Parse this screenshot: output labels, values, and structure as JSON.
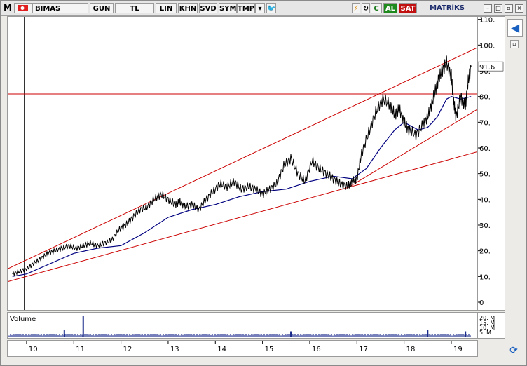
{
  "toolbar": {
    "symbol": "BIMAS",
    "period": "GUN",
    "currency": "TL",
    "buttons": [
      "LIN",
      "KHN",
      "SVD",
      "SYM",
      "TMP"
    ],
    "al": "AL",
    "sat": "SAT",
    "brand": "MATRiKS",
    "c_label": "C",
    "app_letter": "M"
  },
  "colors": {
    "price": "#000000",
    "ma": "#000080",
    "trend": "#cc0000",
    "al_bg": "#1e8a1e",
    "sat_bg": "#c01010"
  },
  "chart_data": {
    "type": "line",
    "title": "",
    "xlabel": "",
    "ylabel": "",
    "x_ticks": [
      "10",
      "11",
      "12",
      "13",
      "14",
      "15",
      "16",
      "17",
      "18",
      "19"
    ],
    "y_ticks": [
      "0",
      "10.",
      "20.",
      "30.",
      "40.",
      "50.",
      "60.",
      "70.",
      "80.",
      "90.",
      "100.",
      "110."
    ],
    "ylim": [
      -3,
      111
    ],
    "last_price_label": "91.6",
    "series": [],
    "price": {
      "x": [
        2009.7,
        2009.85,
        2010.0,
        2010.15,
        2010.3,
        2010.45,
        2010.6,
        2010.75,
        2010.9,
        2011.05,
        2011.2,
        2011.35,
        2011.5,
        2011.65,
        2011.8,
        2011.95,
        2012.1,
        2012.25,
        2012.4,
        2012.55,
        2012.7,
        2012.85,
        2013.0,
        2013.15,
        2013.25,
        2013.35,
        2013.5,
        2013.65,
        2013.8,
        2013.95,
        2014.1,
        2014.25,
        2014.4,
        2014.55,
        2014.7,
        2014.85,
        2015.0,
        2015.15,
        2015.3,
        2015.45,
        2015.6,
        2015.75,
        2015.9,
        2016.05,
        2016.2,
        2016.35,
        2016.5,
        2016.65,
        2016.8,
        2016.9,
        2017.0,
        2017.1,
        2017.25,
        2017.4,
        2017.55,
        2017.7,
        2017.8,
        2017.9,
        2018.0,
        2018.1,
        2018.25,
        2018.4,
        2018.5,
        2018.6,
        2018.7,
        2018.8,
        2018.9,
        2019.0,
        2019.05,
        2019.1,
        2019.2,
        2019.3,
        2019.35,
        2019.42
      ],
      "y": [
        11,
        12,
        13,
        15,
        17,
        19,
        20,
        21,
        22,
        21,
        22,
        23,
        22,
        23,
        24,
        28,
        30,
        33,
        36,
        37,
        40,
        42,
        40,
        38,
        39,
        37,
        38,
        36,
        40,
        43,
        46,
        45,
        47,
        44,
        45,
        44,
        42,
        44,
        46,
        53,
        56,
        50,
        47,
        55,
        52,
        50,
        48,
        46,
        45,
        47,
        48,
        58,
        66,
        74,
        79,
        77,
        73,
        75,
        70,
        67,
        65,
        69,
        72,
        78,
        85,
        90,
        93,
        88,
        78,
        72,
        80,
        76,
        85,
        91.6
      ]
    },
    "moving_average": {
      "x": [
        2009.7,
        2010.0,
        2010.5,
        2011.0,
        2011.5,
        2012.0,
        2012.5,
        2013.0,
        2013.5,
        2014.0,
        2014.5,
        2015.0,
        2015.5,
        2016.0,
        2016.5,
        2016.9,
        2017.2,
        2017.5,
        2017.8,
        2018.0,
        2018.3,
        2018.5,
        2018.7,
        2018.9,
        2019.0,
        2019.2,
        2019.42
      ],
      "y": [
        10,
        11,
        15,
        19,
        21,
        22,
        27,
        33,
        36,
        38,
        41,
        43,
        44,
        47,
        49,
        48,
        52,
        60,
        67,
        70,
        67,
        68,
        72,
        79,
        80,
        79,
        80
      ]
    },
    "volume": {
      "spike_x": [
        2010.8,
        2011.2,
        2015.6,
        2018.5,
        2019.3
      ],
      "spike_v": [
        4,
        12,
        3,
        4,
        3
      ],
      "labels": [
        "20. M",
        "15. M",
        "10. M",
        "5. M"
      ]
    },
    "trendlines": [
      {
        "x": [
          2009.6,
          2019.55
        ],
        "y": [
          13,
          99
        ]
      },
      {
        "x": [
          2009.6,
          2019.55
        ],
        "y": [
          8,
          58.5
        ]
      },
      {
        "x": [
          2009.6,
          2019.55
        ],
        "y": [
          81,
          81
        ]
      },
      {
        "x": [
          2016.85,
          2019.55
        ],
        "y": [
          45,
          75
        ]
      }
    ],
    "vertical_marker_x": 2009.95,
    "volume_title": "Volume"
  }
}
